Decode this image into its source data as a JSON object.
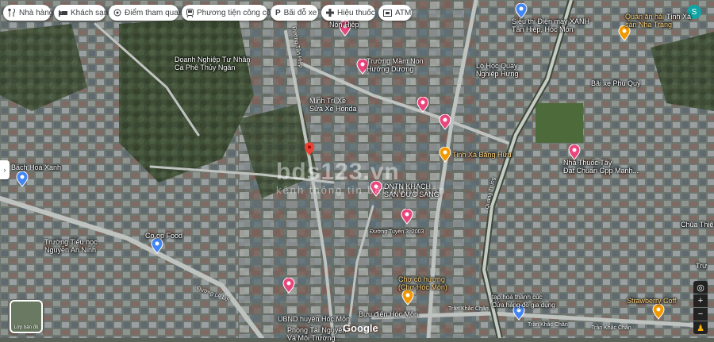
{
  "toolbar": {
    "chips": [
      {
        "label": "Nhà hàng",
        "icon": "restaurant-icon"
      },
      {
        "label": "Khách sạn",
        "icon": "hotel-icon"
      },
      {
        "label": "Điểm tham quan",
        "icon": "attraction-icon"
      },
      {
        "label": "Phương tiện công cộ...",
        "icon": "transit-icon"
      },
      {
        "label": "Bãi đỗ xe",
        "icon": "parking-icon"
      },
      {
        "label": "Hiệu thuốc",
        "icon": "pharmacy-icon"
      },
      {
        "label": "ATM",
        "icon": "atm-icon"
      }
    ]
  },
  "account": {
    "initial": "S"
  },
  "places": [
    {
      "label": "Nón Hiệp"
    },
    {
      "label": "Doanh Nghiệp Tư Nhân\nCà Phê Thủy Ngân"
    },
    {
      "label": "Trường Mầm Non\nHướng Dương"
    },
    {
      "label": "Minh Trí Xe\nSửa Xe Honda"
    },
    {
      "label": "Siêu thị Điện máy XANH\nTân Hiệp, Hóc Môn"
    },
    {
      "label": "Lò Học Quay\nNghiệp Hưng"
    },
    {
      "label": "Quán ăn hải\nsản Nha Trang"
    },
    {
      "label": "Bãi xe Phú Quý"
    },
    {
      "label": "Nhà Thuốc Tây\nĐạt Chuẩn Gpp Mạnh..."
    },
    {
      "label": "Tịnh Xá Bằng Hữu"
    },
    {
      "label": "Bách Hoá Xanh"
    },
    {
      "label": "DNTN KHÁCH\nSẠN ĐỨC SANG"
    },
    {
      "label": "Đường Tuyến 3, 2003"
    },
    {
      "label": "Trường Tiểu học\nNguyễn An Ninh"
    },
    {
      "label": "Co.op Food"
    },
    {
      "label": "Chợ cô hương\n(Chợ Hóc Môn)"
    },
    {
      "label": "tạp hoá thanh cúc\nCửa hàng đồ gia dụng"
    },
    {
      "label": "UBND huyện Hóc Môn"
    },
    {
      "label": "Bưu điện Hóc Môn"
    },
    {
      "label": "Phòng Tài Nguyên\nVà Môi Trường..."
    },
    {
      "label": "Chùa Thiện"
    },
    {
      "label": "Strawberry Coff"
    },
    {
      "label": "Trư"
    },
    {
      "label": "Tịnh Xá"
    }
  ],
  "roads": [
    {
      "label": "Trần Khắc Chân"
    },
    {
      "label": "Trần Khắc Chân"
    },
    {
      "label": "Trần Khắc Chân"
    },
    {
      "label": "Đường Tân Hiệp"
    },
    {
      "label": "Quang Trung"
    },
    {
      "label": "Đường Lê Lợi"
    }
  ],
  "watermark": {
    "line1": "bds123.vn",
    "line2": "kênh thông tin bất động sản"
  },
  "layer_button": {
    "label": "Lớp bản đồ"
  },
  "attribution": {
    "logo": "Google"
  },
  "colors": {
    "pin_red": "#ea4335",
    "pin_pink": "#e8467c",
    "pin_orange": "#f29900",
    "pin_blue": "#4285f4"
  }
}
